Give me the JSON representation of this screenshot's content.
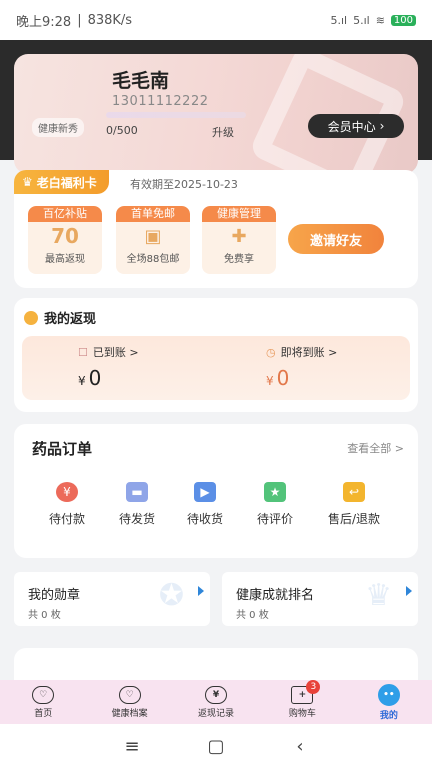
{
  "status_bar": {
    "time": "晚上9:28",
    "speed": "838K/s",
    "signal1": "5.ıl",
    "signal2": "5.ıl",
    "wifi": "≋",
    "battery": "100"
  },
  "member": {
    "name": "毛毛南",
    "phone": "13011112222",
    "level": "健康新秀",
    "progress": "0/500",
    "upgrade": "升级",
    "center_btn": "会员中心"
  },
  "benefit": {
    "tag": "老白福利卡",
    "validity": "有效期至2025-10-23",
    "items": [
      {
        "title": "百亿补贴",
        "visual": "70",
        "sub": "最高返现"
      },
      {
        "title": "首单免邮",
        "visual": "▣",
        "sub": "全场88包邮"
      },
      {
        "title": "健康管理",
        "visual": "✚",
        "sub": "免费享"
      }
    ],
    "invite_btn": "邀请好友"
  },
  "cashback": {
    "title": "我的返现",
    "received_label": "已到账 >",
    "received_currency": "¥",
    "received_amount": "0",
    "pending_label": "即将到账 >",
    "pending_currency": "¥",
    "pending_amount": "0"
  },
  "orders": {
    "title": "药品订单",
    "view_all": "查看全部 >",
    "items": [
      {
        "label": "待付款",
        "icon": "¥",
        "color": "#ec6a5a"
      },
      {
        "label": "待发货",
        "icon": "▬",
        "color": "#8fa5e8"
      },
      {
        "label": "待收货",
        "icon": "▶",
        "color": "#5b8fe6"
      },
      {
        "label": "待评价",
        "icon": "★",
        "color": "#52c37a"
      },
      {
        "label": "售后/退款",
        "icon": "↩",
        "color": "#f3b52e"
      }
    ]
  },
  "medals": {
    "left_title": "我的勋章",
    "left_count": "共 0 枚",
    "right_title": "健康成就排名",
    "right_count": "共 0 枚"
  },
  "tabs": [
    {
      "label": "首页",
      "icon": "♡"
    },
    {
      "label": "健康档案",
      "icon": "♡"
    },
    {
      "label": "返现记录",
      "icon": "¥"
    },
    {
      "label": "购物车",
      "icon": "+",
      "badge": "3"
    },
    {
      "label": "我的",
      "icon": "••"
    }
  ],
  "colors": {
    "accent_orange": "#f58a4a",
    "accent_blue": "#2f6bd8",
    "tab_bg": "#f8e3f0"
  }
}
